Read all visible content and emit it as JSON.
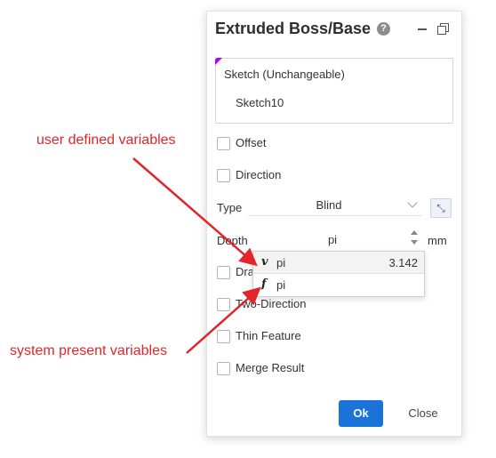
{
  "dialog": {
    "title": "Extruded Boss/Base",
    "help_icon": "question-mark-icon",
    "help_glyph": "?",
    "minimize_icon": "minimize-icon",
    "restore_icon": "restore-window-icon"
  },
  "sketch": {
    "label": "Sketch (Unchangeable)",
    "value": "Sketch10",
    "corner_color": "#b000ff"
  },
  "options": {
    "offset": "Offset",
    "direction": "Direction",
    "type_label": "Type",
    "type_value": "Blind",
    "depth_label": "Depth",
    "depth_value": "pi",
    "depth_unit": "mm",
    "draft": "Draft",
    "two_direction": "Two-Direction",
    "thin_feature": "Thin Feature",
    "merge_result": "Merge Result"
  },
  "variable_dropdown": {
    "items": [
      {
        "icon": "v",
        "icon_name": "user-variable-icon",
        "name": "pi",
        "value": "3.142"
      },
      {
        "icon": "f",
        "icon_name": "system-function-icon",
        "name": "pi",
        "value": ""
      }
    ]
  },
  "buttons": {
    "ok": "Ok",
    "close": "Close",
    "accent": "#1a73d9"
  },
  "annotations": {
    "user_defined": "user defined variables",
    "system_present": "system present variables",
    "color": "#e1252a"
  }
}
